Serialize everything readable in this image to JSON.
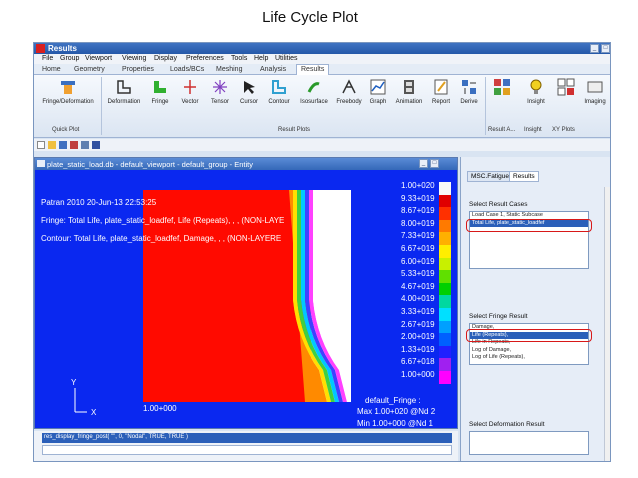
{
  "slide_title": "Life Cycle Plot",
  "window": {
    "title": "Results",
    "buttons": [
      "_",
      "□"
    ]
  },
  "menu": [
    "File",
    "Group",
    "Viewport",
    "Viewing",
    "Display",
    "Preferences",
    "Tools",
    "Help",
    "Utilities"
  ],
  "ribbon_tabs": [
    "Home",
    "Geometry",
    "Properties",
    "Loads/BCs",
    "Meshing",
    "Analysis",
    "Results"
  ],
  "active_tab": "Results",
  "ribbon_buttons": [
    "Fringe/Deformation",
    "Deformation",
    "Fringe",
    "Vector",
    "Tensor",
    "Cursor",
    "Contour",
    "Isosurface",
    "Freebody",
    "Graph",
    "Animation",
    "Report",
    "Derive",
    "Insight",
    "Imaging"
  ],
  "ribbon_groups": [
    "Quick Plot",
    "Result Plots",
    "Result A...",
    "Insight",
    "XY Plots"
  ],
  "viewport": {
    "title": "plate_static_load.db - default_viewport - default_group - Entity",
    "ann1": "Patran 2010 20-Jun-13 22:53:25",
    "ann2": "Fringe: Total Life, plate_static_loadfef, Life (Repeats), , , (NON-LAYE",
    "ann3": "Contour: Total Life, plate_static_loadfef, Damage, , , (NON-LAYERE",
    "bottom_value": "1.00+000",
    "axis_y": "Y",
    "axis_x": "X",
    "legend_title": "default_Fringe :",
    "max_label": "Max 1.00+020 @Nd 2",
    "min_label": "Min 1.00+000 @Nd 1",
    "legend_values": [
      "1.00+020",
      "9.33+019",
      "8.67+019",
      "8.00+019",
      "7.33+019",
      "6.67+019",
      "6.00+019",
      "5.33+019",
      "4.67+019",
      "4.00+019",
      "3.33+019",
      "2.67+019",
      "2.00+019",
      "1.33+019",
      "6.67+018",
      "1.00+000"
    ],
    "legend_colors": [
      "#f8f8f8",
      "#e00000",
      "#ff3000",
      "#ff7a00",
      "#ffb000",
      "#ffee00",
      "#c8f000",
      "#60e000",
      "#00d000",
      "#00d8a0",
      "#00e0ff",
      "#00a0ff",
      "#0060ff",
      "#2020ff",
      "#a020f0",
      "#ff00ff"
    ]
  },
  "properties": {
    "tabs": [
      "MSC.Fatigue",
      "Results"
    ],
    "active_tab": "Results",
    "result_cases_label": "Select Result Cases",
    "result_cases": [
      "Load Case 1, Static Subcase",
      "Total Life, plate_static_loadfef"
    ],
    "selected_case": "Total Life, plate_static_loadfef",
    "fringe_label": "Select Fringe Result",
    "fringe_results": [
      "Damage,",
      "Life (Repeats),",
      "Life in Repeats,",
      "Log of Damage,",
      "Log of Life (Repeats),"
    ],
    "selected_fringe": "Life (Repeats),",
    "deformation_label": "Select Deformation Result"
  },
  "command_line": "res_display_fringe_post( \"\", 0, \"Nodal\", TRUE, TRUE )"
}
